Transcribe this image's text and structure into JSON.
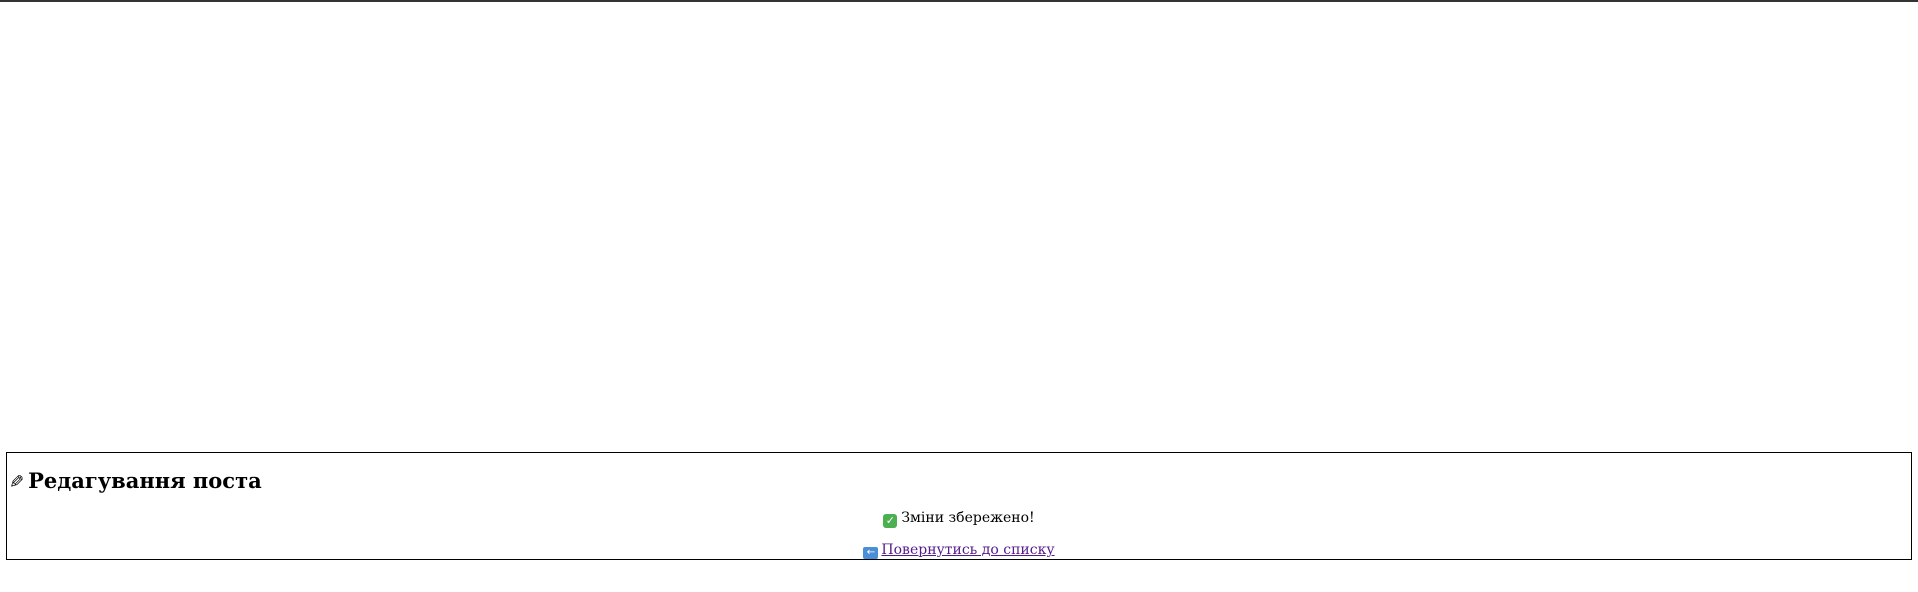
{
  "page": {
    "title": "Редагування поста",
    "title_icon": "pencil-icon",
    "status_icon": "check-mark-icon",
    "status_message": "Зміни збережено!",
    "back_icon": "back-arrow-icon",
    "back_link_label": "Повернутись до списку",
    "status_icon_color": "#4caf50",
    "back_icon_color": "#4a8fd6",
    "link_color": "#551a8b"
  }
}
